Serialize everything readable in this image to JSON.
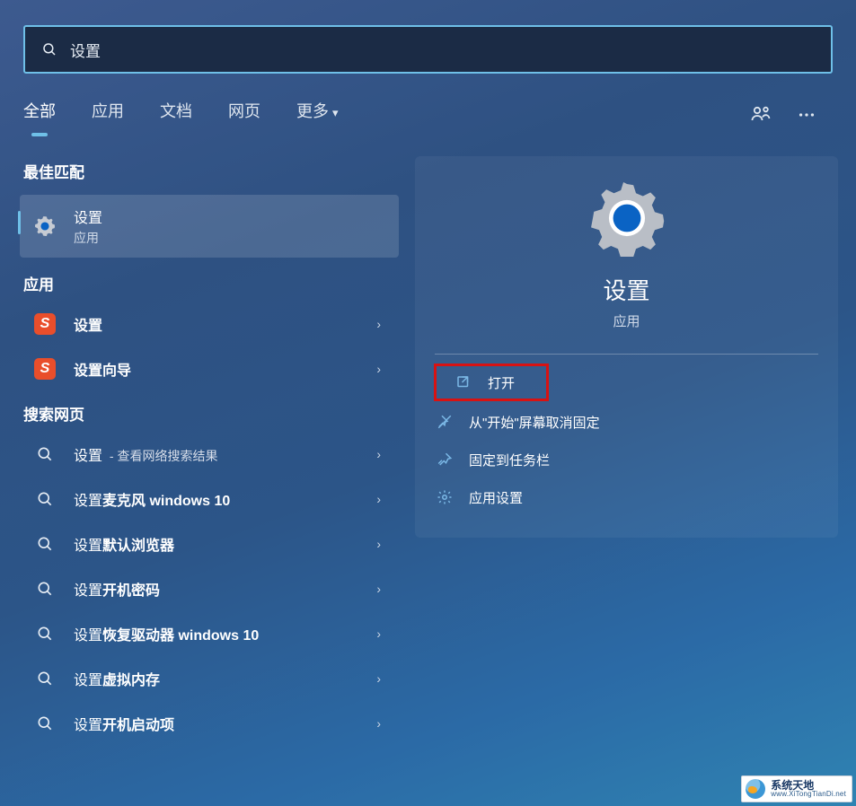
{
  "search": {
    "query": "设置"
  },
  "tabs": {
    "all": "全部",
    "apps": "应用",
    "docs": "文档",
    "web": "网页",
    "more": "更多"
  },
  "sections": {
    "best": "最佳匹配",
    "apps": "应用",
    "search_web": "搜索网页"
  },
  "best_match": {
    "title": "设置",
    "subtitle": "应用"
  },
  "app_results": [
    {
      "label": "设置",
      "icon": "sogou"
    },
    {
      "label": "设置向导",
      "icon": "sogou"
    }
  ],
  "web_results": [
    {
      "prefix": "设置",
      "suffix": " - 查看网络搜索结果"
    },
    {
      "prefix": "设置",
      "bold": "麦克风 windows 10"
    },
    {
      "prefix": "设置",
      "bold": "默认浏览器"
    },
    {
      "prefix": "设置",
      "bold": "开机密码"
    },
    {
      "prefix": "设置",
      "bold": "恢复驱动器 windows 10"
    },
    {
      "prefix": "设置",
      "bold": "虚拟内存"
    },
    {
      "prefix": "设置",
      "bold": "开机启动项"
    }
  ],
  "detail": {
    "title": "设置",
    "subtitle": "应用",
    "actions": {
      "open": "打开",
      "unpin_start": "从\"开始\"屏幕取消固定",
      "pin_taskbar": "固定到任务栏",
      "app_settings": "应用设置"
    }
  },
  "watermark": {
    "cn": "系统天地",
    "url": "www.XiTongTianDi.net"
  }
}
